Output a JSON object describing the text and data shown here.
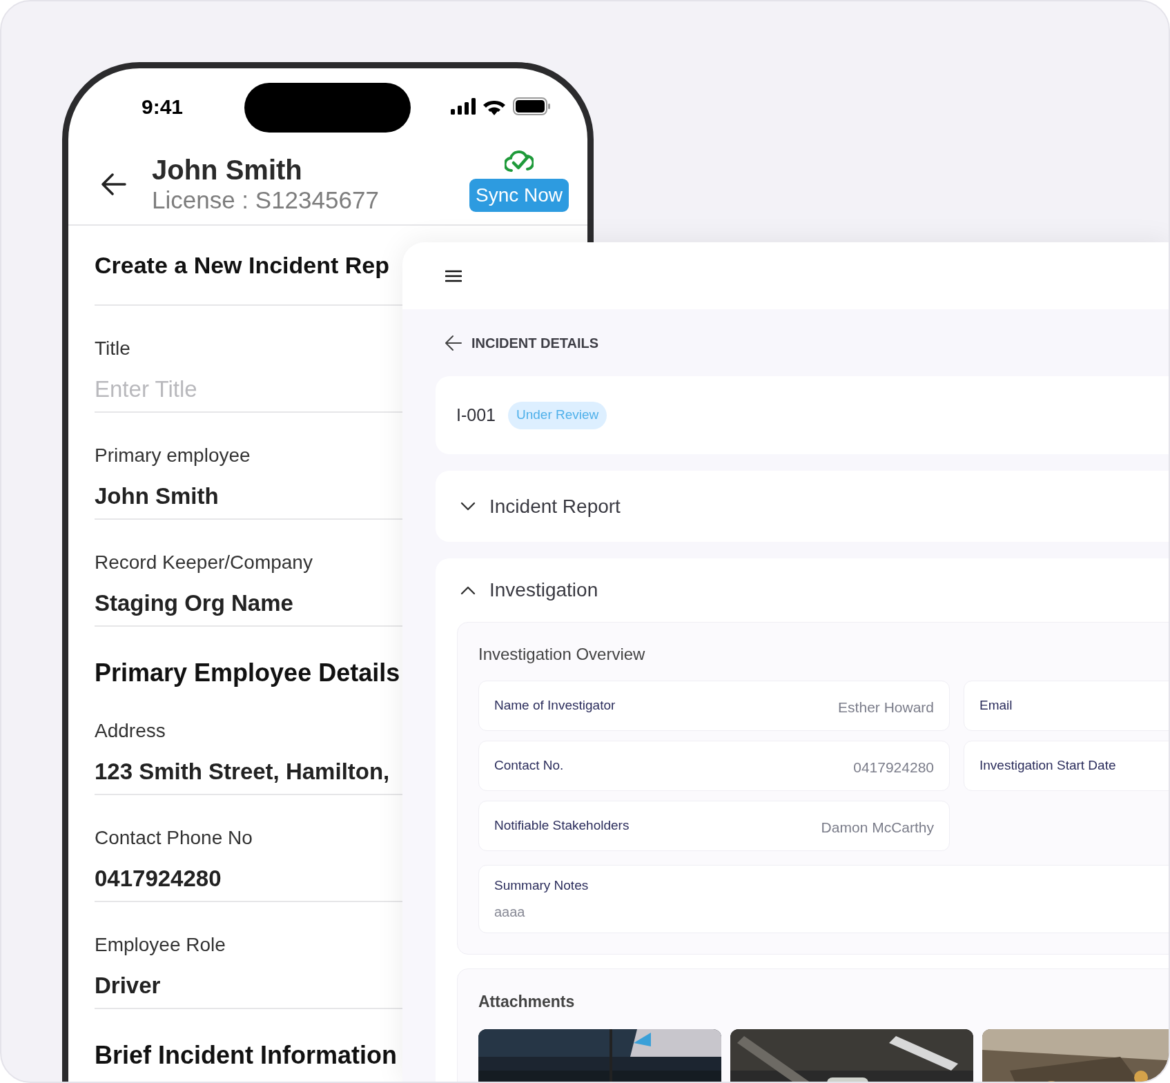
{
  "phone": {
    "status_bar": {
      "time": "9:41"
    },
    "header": {
      "name": "John Smith",
      "license": "License : S12345677",
      "sync_button": "Sync Now"
    },
    "form": {
      "title": "Create a New Incident Rep",
      "items": [
        {
          "kind": "field",
          "label": "Title",
          "placeholder": "Enter Title"
        },
        {
          "kind": "field",
          "label": "Primary employee",
          "value": "John Smith"
        },
        {
          "kind": "field",
          "label": "Record Keeper/Company",
          "value": "Staging Org Name"
        },
        {
          "kind": "heading",
          "text": "Primary Employee Details"
        },
        {
          "kind": "field",
          "label": "Address",
          "value": "123 Smith Street, Hamilton,"
        },
        {
          "kind": "field",
          "label": "Contact Phone No",
          "value": "0417924280"
        },
        {
          "kind": "field",
          "label": "Employee Role",
          "value": "Driver"
        },
        {
          "kind": "heading",
          "text": "Brief Incident Information"
        }
      ]
    }
  },
  "incident_panel": {
    "page_title": "INCIDENT DETAILS",
    "incident": {
      "id": "I-001",
      "status": "Under Review"
    },
    "sections": [
      {
        "title": "Incident Report",
        "expanded": false
      },
      {
        "title": "Investigation",
        "expanded": true,
        "overview": {
          "title": "Investigation Overview",
          "fields": [
            {
              "label": "Name of Investigator",
              "value": "Esther Howard"
            },
            {
              "label": "Email"
            },
            {
              "label": "Contact No.",
              "value": "0417924280"
            },
            {
              "label": "Investigation Start Date"
            },
            {
              "label": "Notifiable Stakeholders",
              "value": "Damon McCarthy"
            }
          ],
          "summary": {
            "label": "Summary Notes",
            "value": "aaaa"
          }
        },
        "attachments": {
          "title": "Attachments"
        }
      }
    ]
  }
}
